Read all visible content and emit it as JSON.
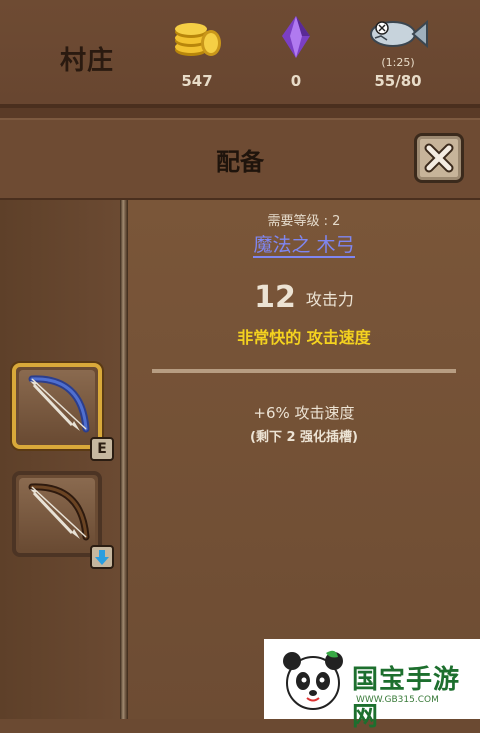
{
  "header": {
    "village_label": "村庄",
    "gold": "547",
    "gems": "0",
    "fish_timer": "(1:25)",
    "fish": "55/80"
  },
  "panel": {
    "title": "配备"
  },
  "item": {
    "required_level": "需要等级 : 2",
    "name": "魔法之 木弓",
    "attack_value": "12",
    "attack_label": "攻击力",
    "speed_text": "非常快的 攻击速度",
    "bonus": "+6% 攻击速度",
    "slots_left": "(剩下 2 强化插槽)"
  },
  "slots": [
    {
      "badge": "E",
      "selected": true
    },
    {
      "badge": "down-arrow",
      "selected": false
    }
  ],
  "watermark": {
    "brand": "国宝手游网",
    "url": "WWW.GB315.COM"
  },
  "colors": {
    "background": "#6b4a32",
    "item_name": "#7f86f0",
    "speed_text": "#f4d21f",
    "selected_border": "#d9a93a"
  }
}
